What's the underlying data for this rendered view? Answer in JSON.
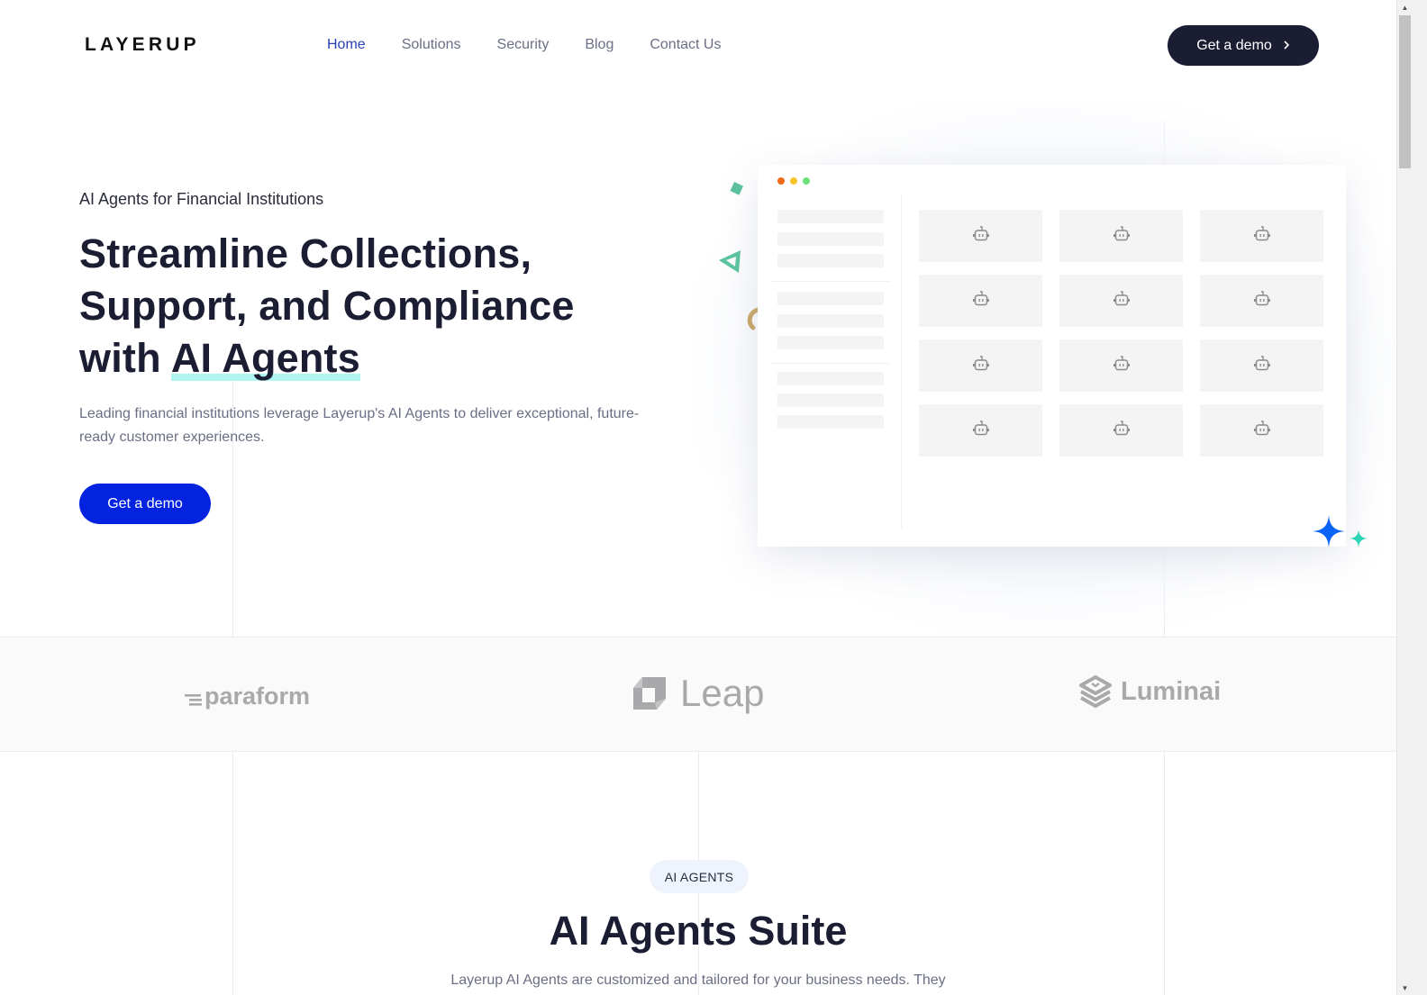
{
  "header": {
    "logo": "LAYERUP",
    "nav": [
      {
        "label": "Home",
        "active": true
      },
      {
        "label": "Solutions",
        "active": false
      },
      {
        "label": "Security",
        "active": false
      },
      {
        "label": "Blog",
        "active": false
      },
      {
        "label": "Contact Us",
        "active": false
      }
    ],
    "cta_label": "Get a demo",
    "cta_icon": "chevron-right-icon"
  },
  "hero": {
    "eyebrow": "AI Agents for Financial Institutions",
    "title_line1": "Streamline Collections,",
    "title_line2": "Support, and Compliance",
    "title_line3_prefix": "with ",
    "title_highlight": "AI Agents",
    "subtitle": "Leading financial institutions leverage Layerup's AI Agents to deliver exceptional, future-ready customer experiences.",
    "cta_label": "Get a demo"
  },
  "mockup": {
    "window_dots": [
      "#f06a1a",
      "#f7c52b",
      "#6ee07a"
    ],
    "grid_rows": 4,
    "grid_cols": 3,
    "cell_icon": "robot-icon",
    "sidebar_groups": [
      3,
      3,
      3
    ]
  },
  "logos": [
    {
      "name": "paraform",
      "label": "paraform"
    },
    {
      "name": "leap",
      "label": "Leap"
    },
    {
      "name": "luminai",
      "label": "Luminai"
    }
  ],
  "section": {
    "pill": "AI AGENTS",
    "title": "AI Agents Suite",
    "subtitle": "Layerup AI Agents are customized and tailored for your business needs. They"
  },
  "colors": {
    "primary_dark": "#1b1d33",
    "accent_blue": "#0323e0",
    "nav_active": "#2740b8",
    "highlight": "#aff5f0",
    "sparkle_blue": "#0b63f6",
    "sparkle_teal": "#2fd3b5"
  }
}
